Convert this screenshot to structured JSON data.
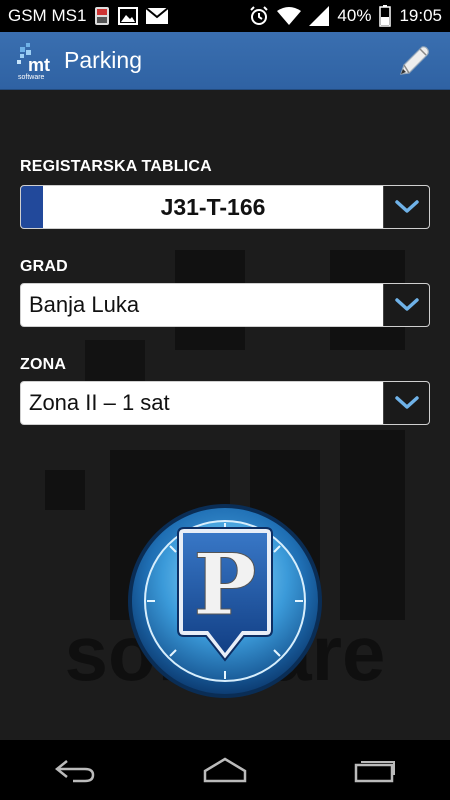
{
  "status_bar": {
    "carrier": "GSM MS1",
    "battery_percent": "40%",
    "time": "19:05"
  },
  "app_bar": {
    "title": "Parking"
  },
  "form": {
    "plate": {
      "label": "REGISTARSKA TABLICA",
      "value": "J31-T-166"
    },
    "city": {
      "label": "GRAD",
      "value": "Banja Luka"
    },
    "zone": {
      "label": "ZONA",
      "value": "Zona II – 1 sat"
    }
  },
  "parking_button": {
    "letter": "P"
  },
  "watermark": {
    "text": "software"
  },
  "logo": {
    "text": "mt",
    "subtext": "software"
  },
  "colors": {
    "action_bar": "#3a6fb0",
    "plate_flag": "#22499b",
    "dropdown_arrow": "#6fb2e8"
  }
}
